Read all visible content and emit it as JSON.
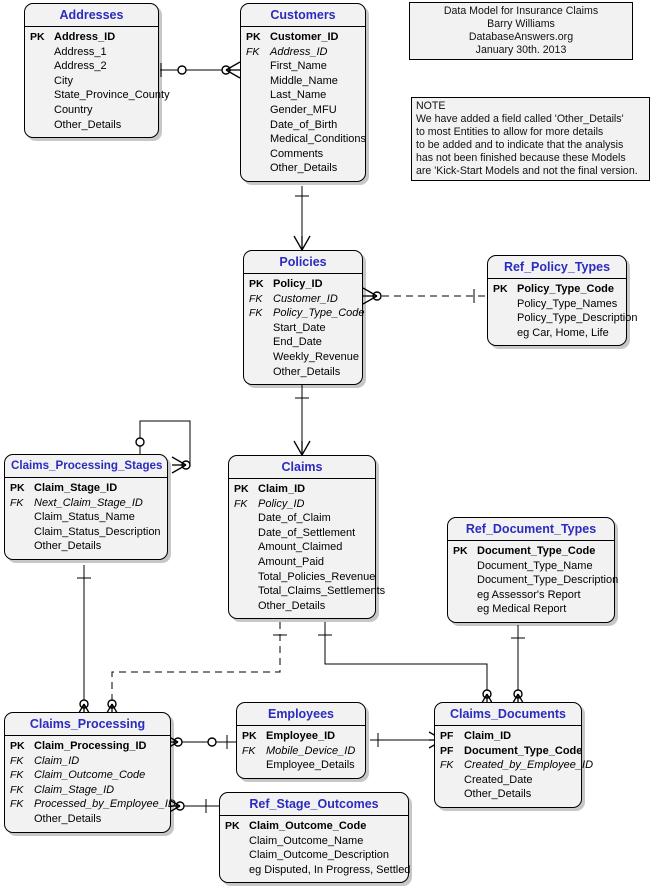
{
  "diagram": {
    "kind": "entity-relationship-diagram",
    "notation": "crows-foot (IDEF1X-style)",
    "title_box": {
      "lines": [
        "Data Model for Insurance Claims",
        "Barry Williams",
        "DatabaseAnswers.org",
        "January 30th. 2013"
      ]
    },
    "note_box": {
      "lines": [
        "NOTE",
        "We have added a field called 'Other_Details'",
        "to most Entities to allow for more details",
        "to be added and to indicate that the analysis",
        "has not been finished because these Models",
        "are 'Kick-Start Models and not the final version."
      ]
    },
    "colors": {
      "entity_title": "#2b2bbf",
      "entity_fill": "#f2f2f2",
      "entity_border": "#000000",
      "line": "#000000",
      "page_background": "#ffffff"
    },
    "entities": [
      {
        "id": "addresses",
        "name": "Addresses",
        "attributes": [
          {
            "key": "PK",
            "name": "Address_ID"
          },
          {
            "key": "",
            "name": "Address_1"
          },
          {
            "key": "",
            "name": "Address_2"
          },
          {
            "key": "",
            "name": "City"
          },
          {
            "key": "",
            "name": "State_Province_County"
          },
          {
            "key": "",
            "name": "Country"
          },
          {
            "key": "",
            "name": "Other_Details"
          }
        ]
      },
      {
        "id": "customers",
        "name": "Customers",
        "attributes": [
          {
            "key": "PK",
            "name": "Customer_ID"
          },
          {
            "key": "FK",
            "name": "Address_ID"
          },
          {
            "key": "",
            "name": "First_Name"
          },
          {
            "key": "",
            "name": "Middle_Name"
          },
          {
            "key": "",
            "name": "Last_Name"
          },
          {
            "key": "",
            "name": "Gender_MFU"
          },
          {
            "key": "",
            "name": "Date_of_Birth"
          },
          {
            "key": "",
            "name": "Medical_Conditions"
          },
          {
            "key": "",
            "name": "Comments"
          },
          {
            "key": "",
            "name": "Other_Details"
          }
        ]
      },
      {
        "id": "policies",
        "name": "Policies",
        "attributes": [
          {
            "key": "PK",
            "name": "Policy_ID"
          },
          {
            "key": "FK",
            "name": "Customer_ID"
          },
          {
            "key": "FK",
            "name": "Policy_Type_Code"
          },
          {
            "key": "",
            "name": "Start_Date"
          },
          {
            "key": "",
            "name": "End_Date"
          },
          {
            "key": "",
            "name": "Weekly_Revenue"
          },
          {
            "key": "",
            "name": "Other_Details"
          }
        ]
      },
      {
        "id": "ref_policy_types",
        "name": "Ref_Policy_Types",
        "attributes": [
          {
            "key": "PK",
            "name": "Policy_Type_Code"
          },
          {
            "key": "",
            "name": "Policy_Type_Names"
          },
          {
            "key": "",
            "name": "Policy_Type_Description"
          },
          {
            "key": "",
            "name": "eg Car, Home, Life"
          }
        ]
      },
      {
        "id": "claims_processing_stages",
        "name": "Claims_Processing_Stages",
        "attributes": [
          {
            "key": "PK",
            "name": "Claim_Stage_ID"
          },
          {
            "key": "FK",
            "name": "Next_Claim_Stage_ID"
          },
          {
            "key": "",
            "name": "Claim_Status_Name"
          },
          {
            "key": "",
            "name": "Claim_Status_Description"
          },
          {
            "key": "",
            "name": "Other_Details"
          }
        ]
      },
      {
        "id": "claims",
        "name": "Claims",
        "attributes": [
          {
            "key": "PK",
            "name": "Claim_ID"
          },
          {
            "key": "FK",
            "name": "Policy_ID"
          },
          {
            "key": "",
            "name": "Date_of_Claim"
          },
          {
            "key": "",
            "name": "Date_of_Settlement"
          },
          {
            "key": "",
            "name": "Amount_Claimed"
          },
          {
            "key": "",
            "name": "Amount_Paid"
          },
          {
            "key": "",
            "name": "Total_Policies_Revenue"
          },
          {
            "key": "",
            "name": "Total_Claims_Settlements"
          },
          {
            "key": "",
            "name": "Other_Details"
          }
        ]
      },
      {
        "id": "ref_document_types",
        "name": "Ref_Document_Types",
        "attributes": [
          {
            "key": "PK",
            "name": "Document_Type_Code"
          },
          {
            "key": "",
            "name": "Document_Type_Name"
          },
          {
            "key": "",
            "name": "Document_Type_Description"
          },
          {
            "key": "",
            "name": "eg Assessor's Report"
          },
          {
            "key": "",
            "name": "eg Medical Report"
          }
        ]
      },
      {
        "id": "claims_processing",
        "name": "Claims_Processing",
        "attributes": [
          {
            "key": "PK",
            "name": "Claim_Processing_ID"
          },
          {
            "key": "FK",
            "name": "Claim_ID"
          },
          {
            "key": "FK",
            "name": "Claim_Outcome_Code"
          },
          {
            "key": "FK",
            "name": "Claim_Stage_ID"
          },
          {
            "key": "FK",
            "name": "Processed_by_Employee_ID"
          },
          {
            "key": "",
            "name": "Other_Details"
          }
        ]
      },
      {
        "id": "employees",
        "name": "Employees",
        "attributes": [
          {
            "key": "PK",
            "name": "Employee_ID"
          },
          {
            "key": "FK",
            "name": "Mobile_Device_ID"
          },
          {
            "key": "",
            "name": "Employee_Details"
          }
        ]
      },
      {
        "id": "claims_documents",
        "name": "Claims_Documents",
        "attributes": [
          {
            "key": "PF",
            "name": "Claim_ID"
          },
          {
            "key": "PF",
            "name": "Document_Type_Code"
          },
          {
            "key": "FK",
            "name": "Created_by_Employee_ID"
          },
          {
            "key": "",
            "name": "Created_Date"
          },
          {
            "key": "",
            "name": "Other_Details"
          }
        ]
      },
      {
        "id": "ref_stage_outcomes",
        "name": "Ref_Stage_Outcomes",
        "attributes": [
          {
            "key": "PK",
            "name": "Claim_Outcome_Code"
          },
          {
            "key": "",
            "name": "Claim_Outcome_Name"
          },
          {
            "key": "",
            "name": "Claim_Outcome_Description"
          },
          {
            "key": "",
            "name": "eg Disputed, In Progress, Settled"
          }
        ]
      }
    ],
    "relationships": [
      {
        "from": "addresses",
        "to": "customers",
        "style": "solid",
        "from_end": "zero-or-one",
        "to_end": "zero-or-many"
      },
      {
        "from": "customers",
        "to": "policies",
        "style": "solid",
        "from_end": "one",
        "to_end": "zero-or-many"
      },
      {
        "from": "ref_policy_types",
        "to": "policies",
        "style": "dashed",
        "from_end": "one",
        "to_end": "zero-or-many"
      },
      {
        "from": "policies",
        "to": "claims",
        "style": "solid",
        "from_end": "one",
        "to_end": "zero-or-many"
      },
      {
        "from": "claims_processing_stages",
        "to": "claims_processing_stages",
        "style": "solid",
        "from_end": "zero-or-one",
        "to_end": "zero-or-many",
        "note": "self-reference via Next_Claim_Stage_ID"
      },
      {
        "from": "claims_processing_stages",
        "to": "claims_processing",
        "style": "solid",
        "from_end": "one",
        "to_end": "zero-or-many"
      },
      {
        "from": "claims",
        "to": "claims_processing",
        "style": "dashed",
        "from_end": "one",
        "to_end": "zero-or-many"
      },
      {
        "from": "claims",
        "to": "claims_documents",
        "style": "solid",
        "from_end": "one",
        "to_end": "zero-or-many"
      },
      {
        "from": "ref_document_types",
        "to": "claims_documents",
        "style": "solid",
        "from_end": "one",
        "to_end": "zero-or-many"
      },
      {
        "from": "employees",
        "to": "claims_processing",
        "style": "solid",
        "from_end": "zero-or-one",
        "to_end": "zero-or-many"
      },
      {
        "from": "employees",
        "to": "claims_documents",
        "style": "solid",
        "from_end": "one",
        "to_end": "zero-or-many"
      },
      {
        "from": "ref_stage_outcomes",
        "to": "claims_processing",
        "style": "solid",
        "from_end": "one",
        "to_end": "zero-or-many"
      }
    ]
  }
}
